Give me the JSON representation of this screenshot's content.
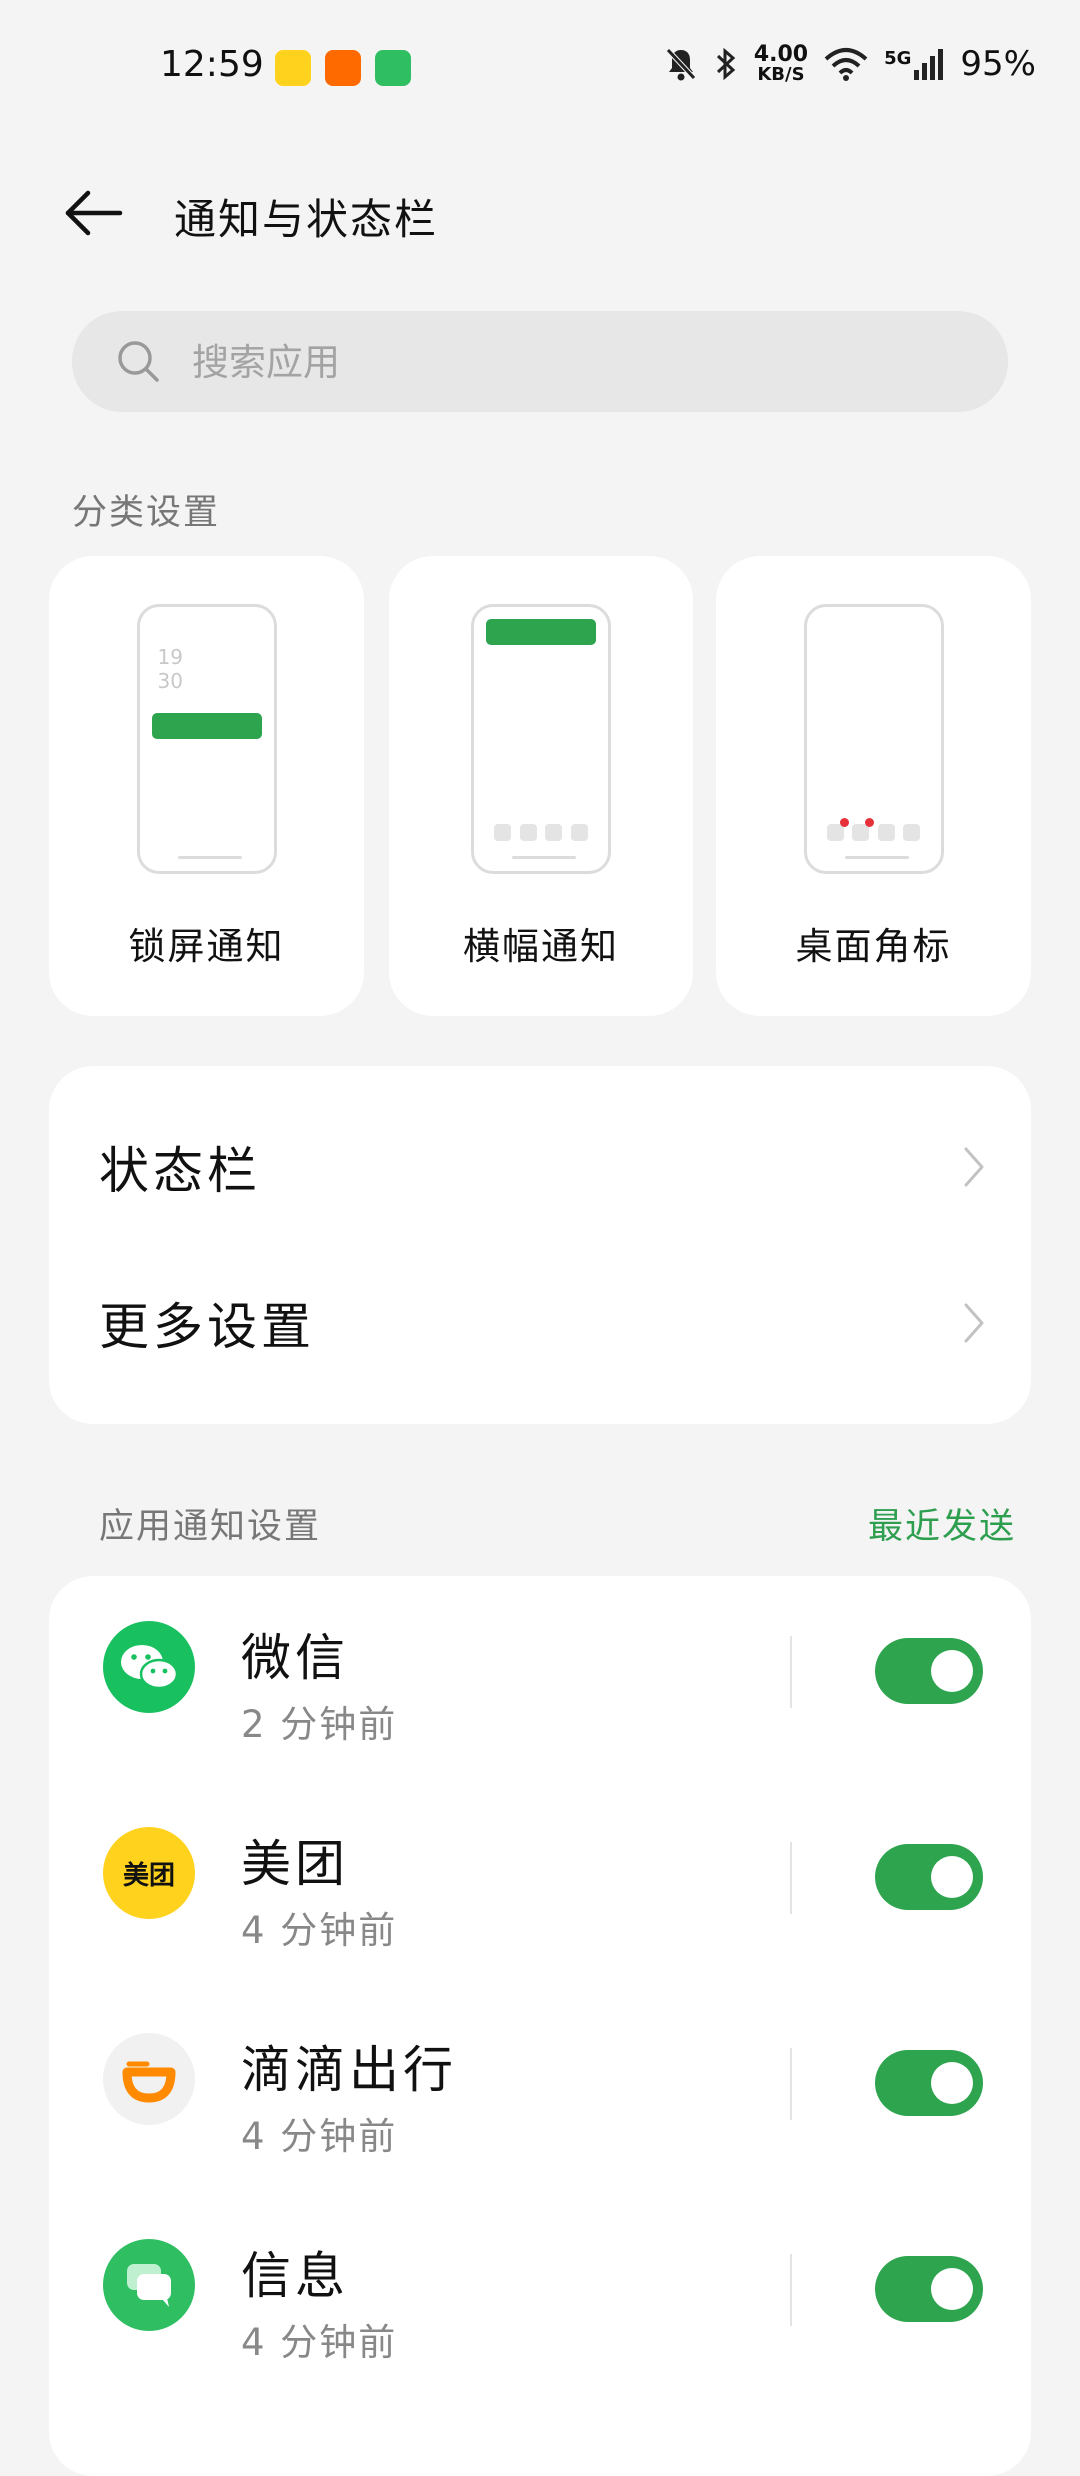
{
  "status_bar": {
    "time": "12:59",
    "net_speed": "4.00",
    "net_unit": "KB/S",
    "signal": "5G",
    "battery": "95%"
  },
  "header": {
    "title": "通知与状态栏"
  },
  "search": {
    "placeholder": "搜索应用"
  },
  "category": {
    "label": "分类设置",
    "lock_time": "19\n30",
    "cards": [
      {
        "label": "锁屏通知"
      },
      {
        "label": "横幅通知"
      },
      {
        "label": "桌面角标"
      }
    ]
  },
  "settings": {
    "items": [
      {
        "label": "状态栏"
      },
      {
        "label": "更多设置"
      }
    ]
  },
  "app_notifications": {
    "label": "应用通知设置",
    "sort": "最近发送",
    "apps": [
      {
        "name": "微信",
        "time": "2 分钟前",
        "enabled": true
      },
      {
        "name": "美团",
        "time": "4 分钟前",
        "enabled": true,
        "icon_text": "美团"
      },
      {
        "name": "滴滴出行",
        "time": "4 分钟前",
        "enabled": true
      },
      {
        "name": "信息",
        "time": "4 分钟前",
        "enabled": true
      }
    ]
  },
  "colors": {
    "accent": "#2ea44f",
    "background": "#f4f4f4",
    "wechat": "#19c060",
    "meituan": "#ffd21e",
    "didi": "#ff8a00",
    "messages": "#2fbf62"
  }
}
